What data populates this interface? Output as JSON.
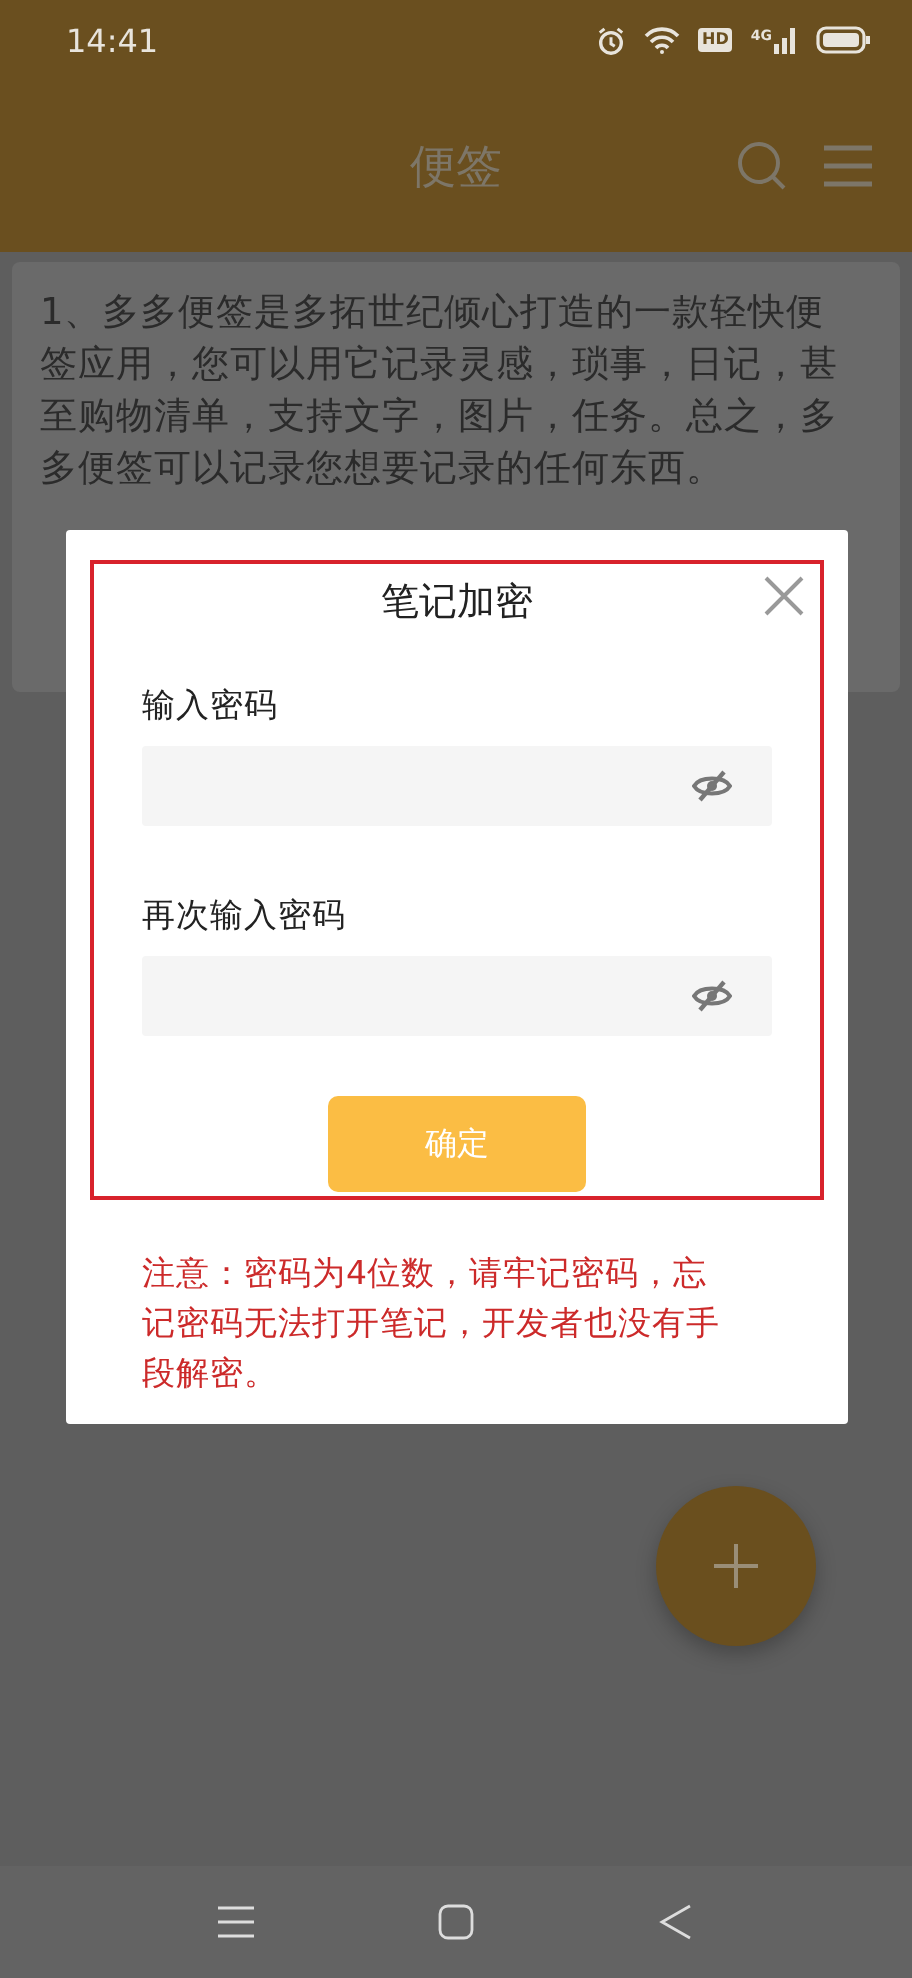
{
  "status_bar": {
    "time": "14:41",
    "hd_label": "HD",
    "network_label": "4G"
  },
  "app_bar": {
    "title": "便签"
  },
  "notes": [
    {
      "text": "1、多多便签是多拓世纪倾心打造的一款轻快便签应用，您可以用它记录灵感，琐事，日记，甚至购物清单，支持文字，图片，任务。总之，多多便签可以记录您想要记录的任何东西。"
    }
  ],
  "dialog": {
    "title": "笔记加密",
    "fields": [
      {
        "label": "输入密码",
        "visible": false
      },
      {
        "label": "再次输入密码",
        "visible": false
      }
    ],
    "confirm_button": "确定",
    "notice": "注意：密码为4位数，请牢记密码，忘记密码无法打开笔记，开发者也没有手段解密。"
  }
}
